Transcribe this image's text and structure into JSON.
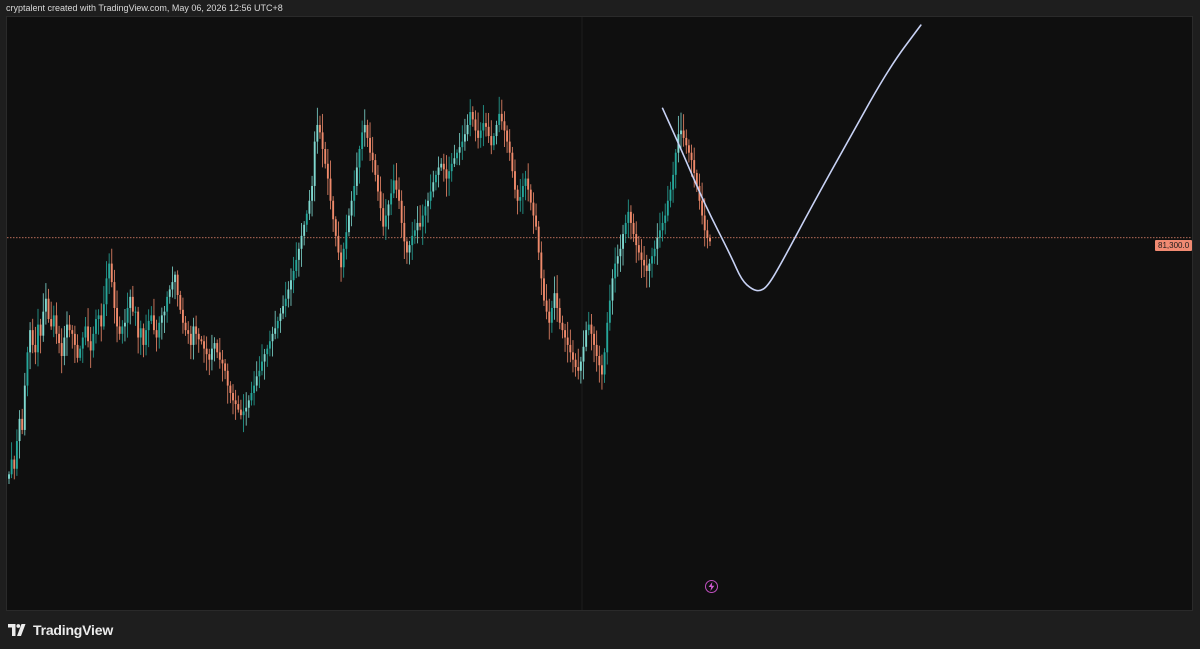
{
  "header": {
    "attribution": "cryptalent created with TradingView.com, May 06, 2026 12:56 UTC+8"
  },
  "footer": {
    "brand": "TradingView"
  },
  "colors": {
    "up": "#26a69a",
    "up_light": "#7fd8cf",
    "down": "#ef8a6b",
    "price_line": "#f08a72",
    "drawing": "#c8d2f5",
    "background": "#0f0f0f"
  },
  "icons": {
    "logo": "tradingview-logo-icon",
    "bolt": "lightning-icon"
  },
  "chart_data": {
    "type": "candlestick",
    "price_line": {
      "value": 81300,
      "label": "81,300.0"
    },
    "y_range": [
      71500,
      87000
    ],
    "closes": [
      74900,
      75300,
      75050,
      75800,
      76400,
      76100,
      77300,
      78200,
      78800,
      78400,
      78200,
      78950,
      78650,
      79300,
      79650,
      79100,
      78900,
      79200,
      78700,
      78450,
      78100,
      78600,
      78950,
      78800,
      78700,
      78400,
      78050,
      78300,
      78600,
      78900,
      78500,
      78250,
      78700,
      79100,
      79200,
      78900,
      79500,
      80200,
      80600,
      80100,
      79400,
      78900,
      78700,
      78900,
      79000,
      79400,
      79700,
      79300,
      79300,
      78600,
      78850,
      78400,
      78800,
      79050,
      79200,
      78800,
      78600,
      79000,
      79200,
      79300,
      79700,
      79900,
      80100,
      80300,
      79750,
      79350,
      79000,
      78800,
      78700,
      78400,
      78900,
      78700,
      78550,
      78500,
      78300,
      78150,
      78000,
      78300,
      78450,
      78200,
      78000,
      77900,
      77700,
      77300,
      77100,
      76900,
      76800,
      76650,
      76500,
      76600,
      76700,
      76900,
      77100,
      77300,
      77550,
      77700,
      77950,
      78150,
      78300,
      78500,
      78700,
      78850,
      79050,
      79250,
      79450,
      79650,
      79900,
      80150,
      80400,
      80700,
      81000,
      81350,
      81650,
      81950,
      82300,
      82700,
      83900,
      84350,
      84150,
      83700,
      83300,
      82900,
      82300,
      81800,
      81350,
      80900,
      80500,
      81000,
      81450,
      81900,
      82300,
      82700,
      83200,
      83700,
      84150,
      84350,
      84000,
      83600,
      83400,
      83000,
      82550,
      82100,
      81600,
      81900,
      82200,
      82500,
      82850,
      82600,
      82300,
      81700,
      81200,
      80900,
      81100,
      81350,
      81500,
      81700,
      81600,
      81900,
      82150,
      82300,
      82550,
      82800,
      83000,
      83200,
      83300,
      83150,
      82900,
      83100,
      83300,
      83450,
      83600,
      83750,
      83900,
      84100,
      84350,
      84700,
      84500,
      84200,
      84000,
      84200,
      84400,
      84300,
      84050,
      83800,
      84050,
      84350,
      84650,
      84450,
      84200,
      83900,
      83600,
      83100,
      82600,
      82300,
      82400,
      82700,
      82900,
      82600,
      82250,
      81900,
      81600,
      80900,
      80200,
      79600,
      79300,
      79000,
      79400,
      79800,
      79400,
      79000,
      78800,
      78600,
      78400,
      78200,
      78000,
      77800,
      77700,
      77950,
      78350,
      78800,
      78950,
      78700,
      78400,
      78100,
      77850,
      77600,
      78200,
      79000,
      79600,
      80200,
      80600,
      80800,
      81000,
      81400,
      81700,
      82000,
      81700,
      81400,
      81100,
      80900,
      80700,
      80550,
      80400,
      80600,
      80800,
      81000,
      81300,
      81500,
      81700,
      81900,
      82300,
      82600,
      83000,
      83600,
      84100,
      84200,
      84000,
      83800,
      83600,
      83400,
      83050,
      82700,
      82300,
      81900,
      81500,
      81300,
      81200
    ],
    "drawing_path": [
      [
        84800,
        0
      ],
      [
        83700,
        7
      ],
      [
        82200,
        16
      ],
      [
        80800,
        26
      ],
      [
        80150,
        30
      ],
      [
        79900,
        34
      ],
      [
        79850,
        37
      ],
      [
        80000,
        40
      ],
      [
        80600,
        45
      ],
      [
        82200,
        57
      ],
      [
        84000,
        71
      ],
      [
        85900,
        86
      ],
      [
        87050,
        98
      ]
    ]
  }
}
